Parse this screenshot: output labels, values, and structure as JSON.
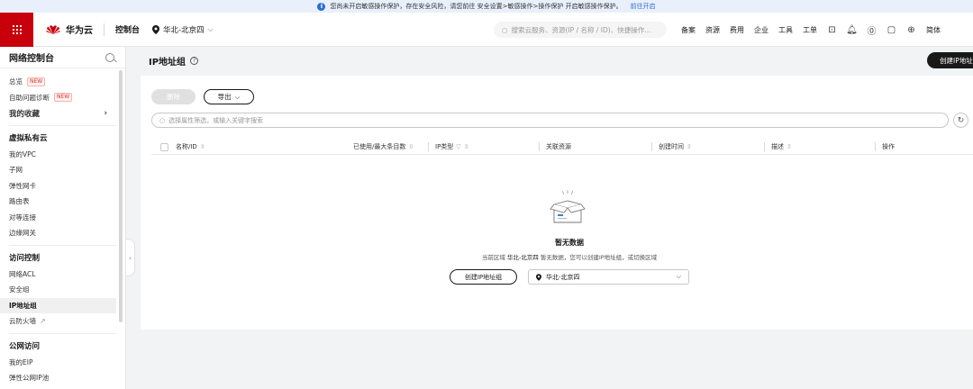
{
  "notice": {
    "icon": "info-icon",
    "text": "您尚未开启敏感操作保护，存在安全风险，请您前往 安全设置>敏感操作>操作保护 开启敏感操作保护。",
    "link": "前往开启"
  },
  "topbar": {
    "brand": "华为云",
    "brand_small": "HUAWEI",
    "console": "控制台",
    "region": "华北-北京四",
    "search_placeholder": "搜索云服务、资源(IP / 名称 / ID)、快捷操作...",
    "nav_links": [
      "备案",
      "资源",
      "费用",
      "企业",
      "工具",
      "工单"
    ],
    "lang": "简体",
    "brand_color": "#c7000b"
  },
  "sidebar": {
    "title": "网络控制台",
    "items": [
      {
        "label": "总览",
        "badge": "NEW"
      },
      {
        "label": "自助问题诊断",
        "badge": "NEW"
      },
      {
        "label": "我的收藏",
        "kind": "collect"
      },
      {
        "label": "虚拟私有云",
        "kind": "group"
      },
      {
        "label": "我的VPC"
      },
      {
        "label": "子网"
      },
      {
        "label": "弹性网卡"
      },
      {
        "label": "路由表"
      },
      {
        "label": "对等连接"
      },
      {
        "label": "边缘网关"
      },
      {
        "label": "访问控制",
        "kind": "group"
      },
      {
        "label": "网络ACL"
      },
      {
        "label": "安全组"
      },
      {
        "label": "IP地址组",
        "kind": "active"
      },
      {
        "label": "云防火墙"
      },
      {
        "label": "公网访问",
        "kind": "group"
      },
      {
        "label": "我的EIP"
      },
      {
        "label": "弹性公网IP池"
      }
    ]
  },
  "page": {
    "title": "IP地址组",
    "create_button": "创建IP地址组",
    "delete_button": "删除",
    "export_button": "导出",
    "filter_placeholder": "选择属性筛选，或输入关键字搜索",
    "columns": [
      "名称/ID",
      "已使用/最大条目数",
      "IP类型",
      "关联资源",
      "创建时间",
      "描述",
      "操作"
    ]
  },
  "empty": {
    "title": "暂无数据",
    "desc_prefix": "当前区域",
    "desc_region": "华北-北京四",
    "desc_suffix": "暂无数据，您可以创建IP地址组，或切换区域",
    "create_button": "创建IP地址组",
    "region_value": "华北-北京四"
  }
}
